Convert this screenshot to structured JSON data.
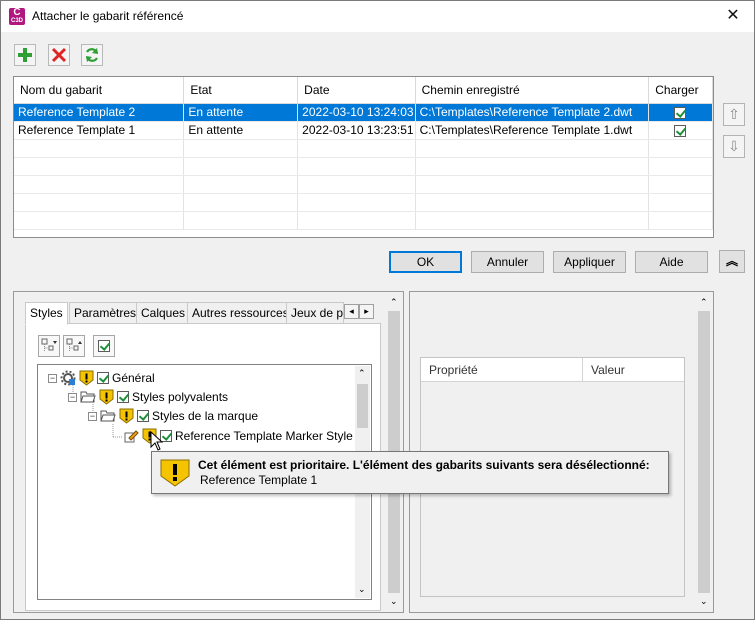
{
  "window": {
    "app_icon_letter": "C",
    "app_icon_year": "C3D",
    "title": "Attacher le gabarit référencé",
    "close_glyph": "✕"
  },
  "toolbar": {
    "add_icon": "plus-icon",
    "remove_icon": "delete-icon",
    "refresh_icon": "refresh-icon"
  },
  "templates": {
    "columns": [
      "Nom du gabarit",
      "Etat",
      "Date",
      "Chemin enregistré",
      "Charger"
    ],
    "rows": [
      {
        "name": "Reference Template 2",
        "state": "En attente",
        "date": "2022-03-10 13:24:03",
        "path": "C:\\Templates\\Reference Template 2.dwt",
        "load": true,
        "selected": true
      },
      {
        "name": "Reference Template 1",
        "state": "En attente",
        "date": "2022-03-10 13:23:51",
        "path": "C:\\Templates\\Reference Template 1.dwt",
        "load": true,
        "selected": false
      }
    ]
  },
  "buttons": {
    "ok": "OK",
    "cancel": "Annuler",
    "apply": "Appliquer",
    "help": "Aide"
  },
  "tabs": [
    "Styles",
    "Paramètres",
    "Calques",
    "Autres ressources",
    "Jeux de pr"
  ],
  "active_tab": "Styles",
  "tree": [
    {
      "label": "Général",
      "level": 0,
      "checked": true
    },
    {
      "label": "Styles polyvalents",
      "level": 1,
      "checked": true
    },
    {
      "label": "Styles de la marque",
      "level": 2,
      "checked": true
    },
    {
      "label": "Reference Template Marker Style",
      "level": 3,
      "checked": true
    }
  ],
  "tooltip": {
    "message": "Cet élément est prioritaire. L'élément des gabarits suivants sera désélectionné:",
    "detail": "Reference Template 1"
  },
  "properties": {
    "col_property": "Propriété",
    "col_value": "Valeur"
  },
  "colors": {
    "selection": "#0078d7",
    "warning": "#f5c400",
    "add_green": "#2e9e35",
    "delete_red": "#e02424",
    "app_magenta": "#b0177f"
  }
}
